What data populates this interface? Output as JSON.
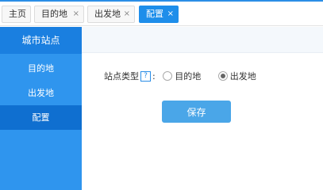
{
  "tabs": [
    {
      "label": "主页",
      "closable": false,
      "active": false
    },
    {
      "label": "目的地",
      "closable": true,
      "active": false
    },
    {
      "label": "出发地",
      "closable": true,
      "active": false
    },
    {
      "label": "配置",
      "closable": true,
      "active": true
    }
  ],
  "tab_close_glyph": "×",
  "sidebar": {
    "header": "城市站点",
    "items": [
      {
        "label": "目的地",
        "active": false
      },
      {
        "label": "出发地",
        "active": false
      },
      {
        "label": "配置",
        "active": true
      }
    ]
  },
  "form": {
    "label": "站点类型",
    "help_glyph": "?",
    "colon": ":",
    "options": [
      {
        "label": "目的地",
        "checked": false
      },
      {
        "label": "出发地",
        "checked": true
      }
    ]
  },
  "save_label": "保存",
  "colors": {
    "accent": "#1e8eea",
    "sidebar": "#2f95ee",
    "sidebar_header": "#1a7fe0",
    "sidebar_active": "#0f6fd0",
    "button": "#4aa6e8"
  }
}
